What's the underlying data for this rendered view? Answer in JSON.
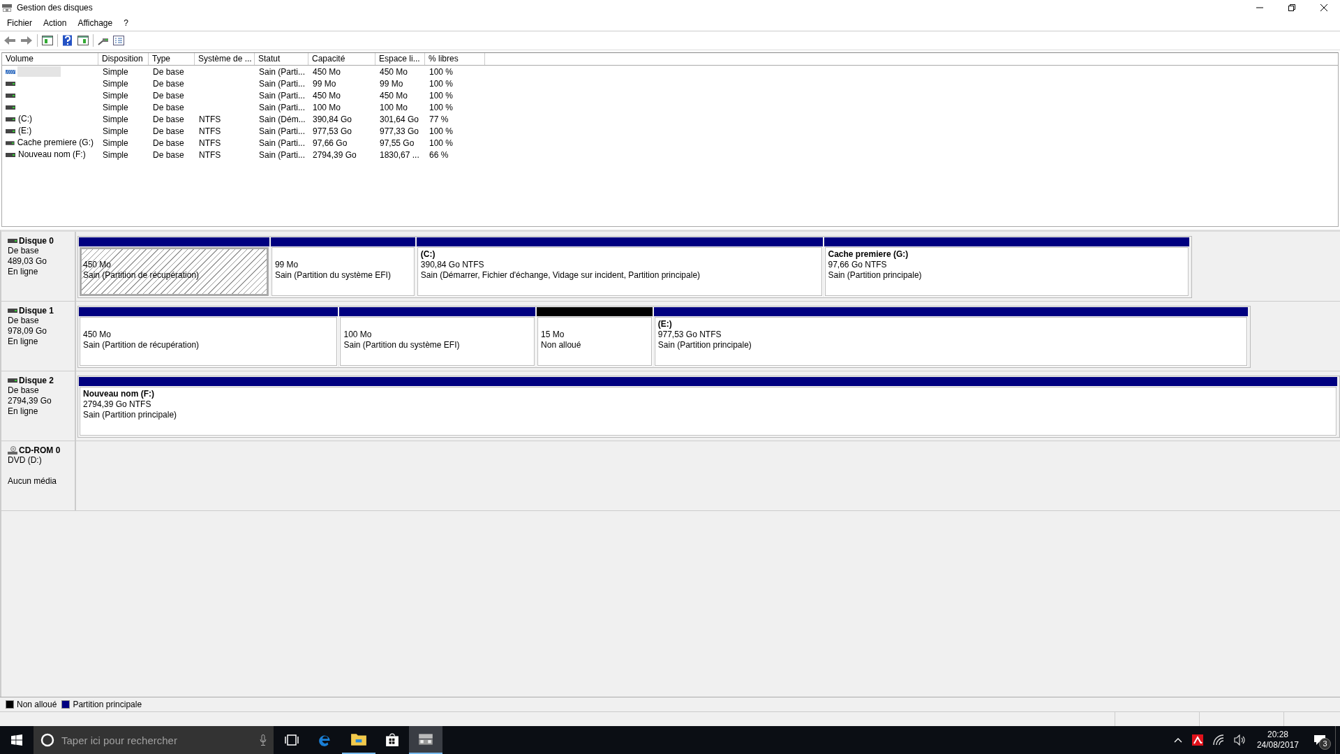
{
  "window": {
    "title": "Gestion des disques"
  },
  "menu": [
    "Fichier",
    "Action",
    "Affichage",
    "?"
  ],
  "table": {
    "columns": [
      "Volume",
      "Disposition",
      "Type",
      "Système de ...",
      "Statut",
      "Capacité",
      "Espace li...",
      "% libres"
    ],
    "rows": [
      {
        "kind": "recovery",
        "selected": true,
        "cells": [
          "",
          "Simple",
          "De base",
          "",
          "Sain (Parti...",
          "450 Mo",
          "450 Mo",
          "100 %"
        ]
      },
      {
        "kind": "partition",
        "selected": false,
        "cells": [
          "",
          "Simple",
          "De base",
          "",
          "Sain (Parti...",
          "99 Mo",
          "99 Mo",
          "100 %"
        ]
      },
      {
        "kind": "partition",
        "selected": false,
        "cells": [
          "",
          "Simple",
          "De base",
          "",
          "Sain (Parti...",
          "450 Mo",
          "450 Mo",
          "100 %"
        ]
      },
      {
        "kind": "partition",
        "selected": false,
        "cells": [
          "",
          "Simple",
          "De base",
          "",
          "Sain (Parti...",
          "100 Mo",
          "100 Mo",
          "100 %"
        ]
      },
      {
        "kind": "partition",
        "selected": false,
        "cells": [
          "(C:)",
          "Simple",
          "De base",
          "NTFS",
          "Sain (Dém...",
          "390,84 Go",
          "301,64 Go",
          "77 %"
        ]
      },
      {
        "kind": "partition",
        "selected": false,
        "cells": [
          "(E:)",
          "Simple",
          "De base",
          "NTFS",
          "Sain (Parti...",
          "977,53 Go",
          "977,33 Go",
          "100 %"
        ]
      },
      {
        "kind": "partition",
        "selected": false,
        "cells": [
          "Cache premiere (G:)",
          "Simple",
          "De base",
          "NTFS",
          "Sain (Parti...",
          "97,66 Go",
          "97,55 Go",
          "100 %"
        ]
      },
      {
        "kind": "partition",
        "selected": false,
        "cells": [
          "Nouveau nom (F:)",
          "Simple",
          "De base",
          "NTFS",
          "Sain (Parti...",
          "2794,39 Go",
          "1830,67 ...",
          "66 %"
        ]
      }
    ]
  },
  "disks": [
    {
      "kind": "disk",
      "name": "Disque 0",
      "info": [
        "De base",
        "489,03 Go",
        "En ligne"
      ],
      "partitions": [
        {
          "kind": "primary",
          "selected": true,
          "lines": [
            "450 Mo",
            "Sain (Partition de récupération)"
          ]
        },
        {
          "kind": "primary",
          "selected": false,
          "lines": [
            "99 Mo",
            "Sain (Partition du système EFI)"
          ]
        },
        {
          "kind": "primary",
          "selected": false,
          "name": "(C:)",
          "lines": [
            "390,84 Go NTFS",
            "Sain (Démarrer, Fichier d'échange, Vidage sur incident, Partition principale)"
          ]
        },
        {
          "kind": "primary",
          "selected": false,
          "name": "Cache premiere  (G:)",
          "lines": [
            "97,66 Go NTFS",
            "Sain (Partition principale)"
          ]
        }
      ]
    },
    {
      "kind": "disk",
      "name": "Disque 1",
      "info": [
        "De base",
        "978,09 Go",
        "En ligne"
      ],
      "partitions": [
        {
          "kind": "primary",
          "selected": false,
          "lines": [
            "450 Mo",
            "Sain (Partition de récupération)"
          ]
        },
        {
          "kind": "primary",
          "selected": false,
          "lines": [
            "100 Mo",
            "Sain (Partition du système EFI)"
          ]
        },
        {
          "kind": "unallocated",
          "selected": false,
          "lines": [
            "15 Mo",
            "Non alloué"
          ]
        },
        {
          "kind": "primary",
          "selected": false,
          "name": "(E:)",
          "lines": [
            "977,53 Go NTFS",
            "Sain (Partition principale)"
          ]
        }
      ]
    },
    {
      "kind": "disk",
      "name": "Disque 2",
      "info": [
        "De base",
        "2794,39 Go",
        "En ligne"
      ],
      "partitions": [
        {
          "kind": "primary",
          "selected": false,
          "name": "Nouveau nom  (F:)",
          "lines": [
            "2794,39 Go NTFS",
            "Sain (Partition principale)"
          ]
        }
      ]
    },
    {
      "kind": "cdrom",
      "name": "CD-ROM 0",
      "info": [
        "DVD (D:)",
        "Aucun média"
      ]
    }
  ],
  "legend": [
    {
      "label": "Non alloué",
      "color": "#000000"
    },
    {
      "label": "Partition principale",
      "color": "#000080"
    }
  ],
  "taskbar": {
    "search": {
      "placeholder": "Taper ici pour rechercher"
    },
    "time": "20:28",
    "date": "24/08/2017",
    "notifications": "3"
  }
}
